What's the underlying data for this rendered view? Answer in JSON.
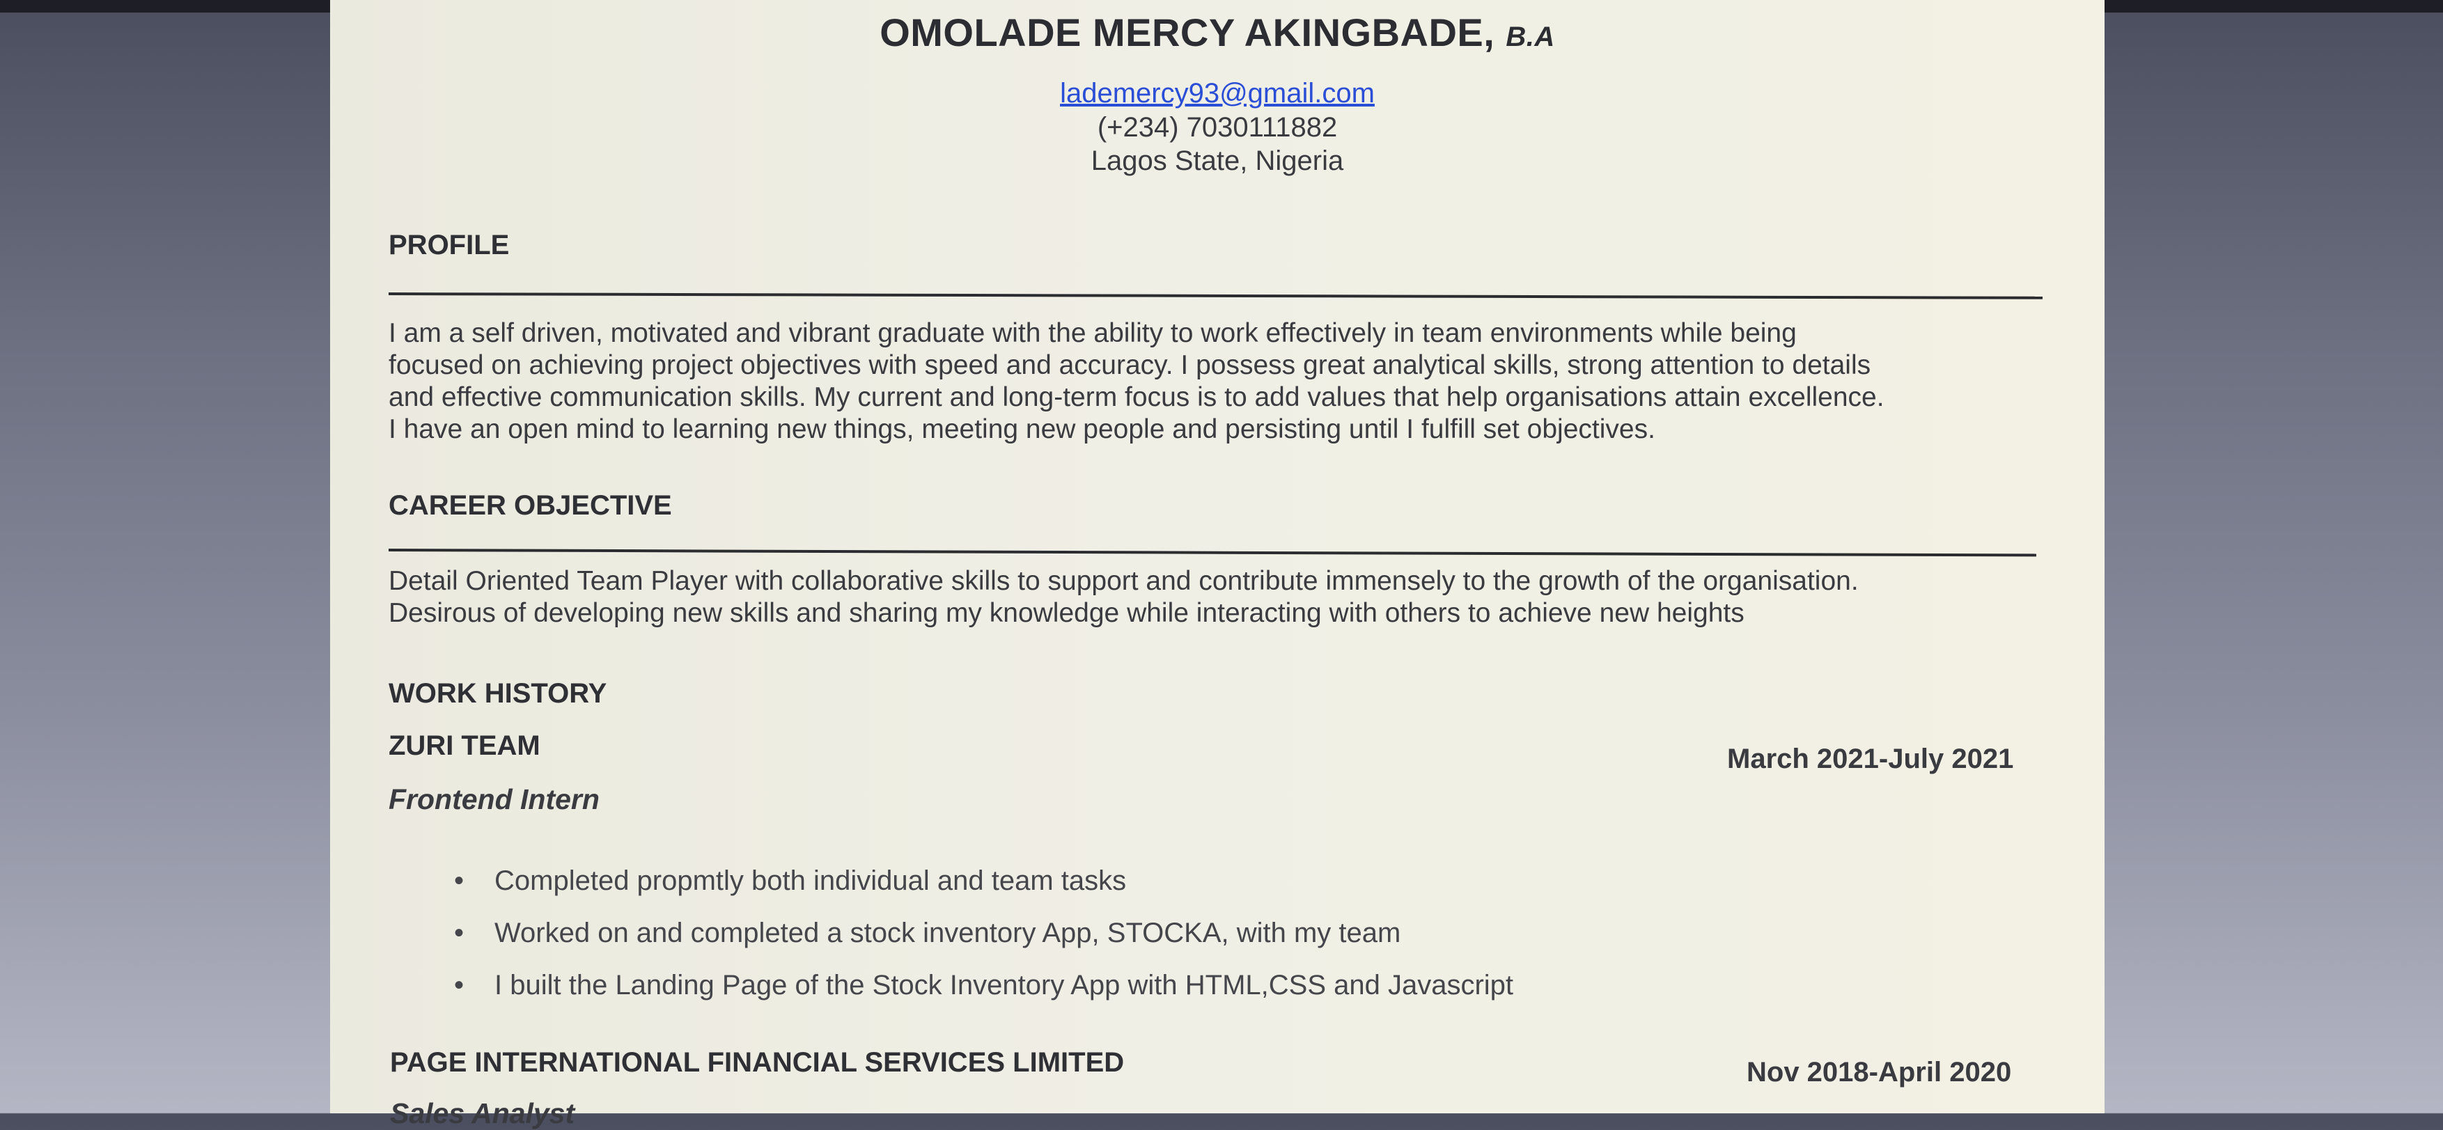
{
  "header": {
    "name": "OMOLADE MERCY AKINGBADE,",
    "credential": "B.A",
    "email": "lademercy93@gmail.com",
    "phone": "(+234) 7030111882",
    "location": "Lagos State, Nigeria"
  },
  "profile": {
    "heading": "PROFILE",
    "lines": [
      "I am a self driven, motivated and vibrant graduate with the ability to work effectively in team environments while being",
      "focused on achieving project objectives with speed and accuracy. I possess great analytical skills, strong attention to details",
      "and effective communication skills. My current and long-term focus is to add values that help organisations attain excellence.",
      "I have an open mind to learning new things, meeting new people and persisting until I fulfill set objectives."
    ]
  },
  "career_objective": {
    "heading": "CAREER OBJECTIVE",
    "lines": [
      "Detail Oriented Team Player with collaborative skills to support and contribute immensely to the growth of the organisation.",
      "Desirous of developing new skills and sharing my knowledge while interacting with others to achieve new heights"
    ]
  },
  "work_history": {
    "heading": "WORK HISTORY",
    "jobs": [
      {
        "company": "ZURI TEAM",
        "dates": "March 2021-July 2021",
        "role": "Frontend Intern",
        "bullets": [
          "Completed propmtly both individual and team tasks",
          "Worked on and completed a stock inventory App, STOCKA, with my team",
          "I built the Landing Page of the Stock Inventory App with HTML,CSS and Javascript"
        ]
      },
      {
        "company": "PAGE INTERNATIONAL FINANCIAL SERVICES LIMITED",
        "dates": "Nov 2018-April 2020",
        "role": "Sales Analyst"
      }
    ]
  }
}
